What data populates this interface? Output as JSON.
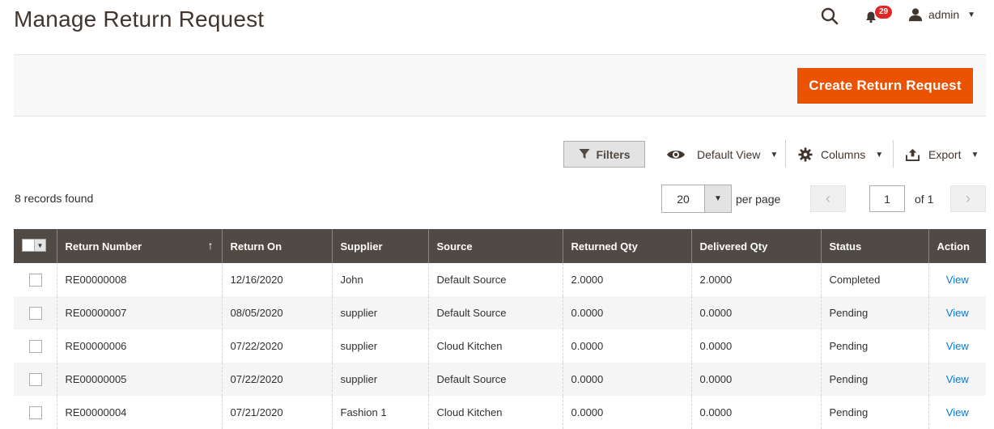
{
  "page": {
    "title": "Manage Return Request"
  },
  "header": {
    "notifications_count": "29",
    "user_name": "admin"
  },
  "action_bar": {
    "create_button": "Create Return Request"
  },
  "toolbar": {
    "filters": "Filters",
    "view": "Default View",
    "columns": "Columns",
    "export": "Export"
  },
  "records": {
    "found": "8 records found",
    "per_page_value": "20",
    "per_page_label": "per page",
    "page_current": "1",
    "page_total": "of 1"
  },
  "table": {
    "columns": [
      "Return Number",
      "Return On",
      "Supplier",
      "Source",
      "Returned Qty",
      "Delivered Qty",
      "Status",
      "Action"
    ],
    "rows": [
      {
        "number": "RE00000008",
        "date": "12/16/2020",
        "supplier": "John",
        "source": "Default Source",
        "returned": "2.0000",
        "delivered": "2.0000",
        "status": "Completed",
        "action": "View"
      },
      {
        "number": "RE00000007",
        "date": "08/05/2020",
        "supplier": "supplier",
        "source": "Default Source",
        "returned": "0.0000",
        "delivered": "0.0000",
        "status": "Pending",
        "action": "View"
      },
      {
        "number": "RE00000006",
        "date": "07/22/2020",
        "supplier": "supplier",
        "source": "Cloud Kitchen",
        "returned": "0.0000",
        "delivered": "0.0000",
        "status": "Pending",
        "action": "View"
      },
      {
        "number": "RE00000005",
        "date": "07/22/2020",
        "supplier": "supplier",
        "source": "Default Source",
        "returned": "0.0000",
        "delivered": "0.0000",
        "status": "Pending",
        "action": "View"
      },
      {
        "number": "RE00000004",
        "date": "07/21/2020",
        "supplier": "Fashion 1",
        "source": "Cloud Kitchen",
        "returned": "0.0000",
        "delivered": "0.0000",
        "status": "Pending",
        "action": "View"
      }
    ]
  },
  "colors": {
    "accent": "#eb5202",
    "header_bg": "#514943",
    "link": "#007bdb",
    "badge": "#e22626"
  }
}
